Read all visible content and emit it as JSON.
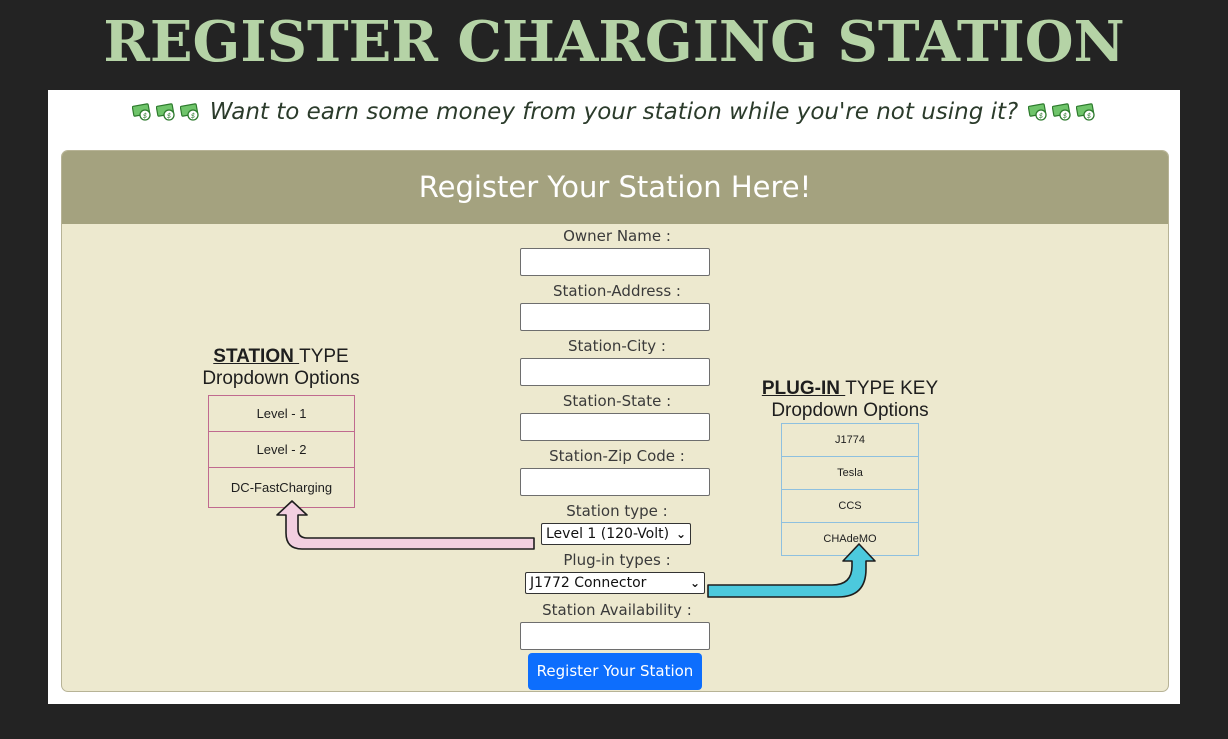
{
  "page_title": "REGISTER CHARGING STATION",
  "tagline": {
    "text": "Want to earn some money from your station while you're not using it?",
    "icon": "money-icon",
    "icon_count_each_side": 3,
    "icon_color": "#3c9a3c"
  },
  "form": {
    "header": "Register Your Station Here!",
    "fields": {
      "owner_name": {
        "label": "Owner Name :",
        "value": ""
      },
      "station_address": {
        "label": "Station-Address :",
        "value": ""
      },
      "station_city": {
        "label": "Station-City :",
        "value": ""
      },
      "station_state": {
        "label": "Station-State :",
        "value": ""
      },
      "station_zip": {
        "label": "Station-Zip Code :",
        "value": ""
      },
      "station_type": {
        "label": "Station type :",
        "selected": "Level 1 (120-Volt)"
      },
      "plugin_types": {
        "label": "Plug-in types :",
        "selected": "J1772 Connector"
      },
      "station_availability": {
        "label": "Station Availability :",
        "value": ""
      }
    },
    "submit_label": "Register Your Station"
  },
  "station_key": {
    "title_bold": "STATION ",
    "title_rest": "TYPE",
    "subtitle": "Dropdown Options",
    "options": [
      "Level - 1",
      "Level - 2",
      "DC-FastCharging"
    ],
    "border_color": "#c06a8f",
    "arrow_color": "#f2cfe0"
  },
  "plug_key": {
    "title_bold": "PLUG-IN ",
    "title_rest": "TYPE KEY",
    "subtitle": "Dropdown Options",
    "options": [
      "J1774",
      "Tesla",
      "CCS",
      "CHAdeMO"
    ],
    "border_color": "#8ec0df",
    "arrow_color": "#4cc9dd"
  },
  "colors": {
    "background": "#232323",
    "title": "#b5d3a6",
    "card_bg": "#ede9cf",
    "card_header": "#a4a27f",
    "button": "#0d6efd"
  }
}
